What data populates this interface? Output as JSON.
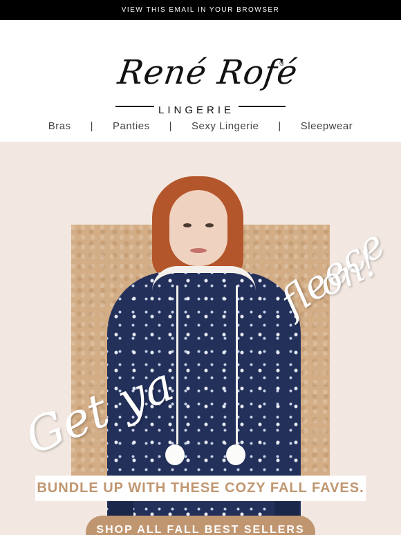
{
  "topbar": {
    "link_text": "VIEW THIS EMAIL IN YOUR BROWSER"
  },
  "brand": {
    "logo_script": "René Rofé",
    "logo_sub": "LINGERIE",
    "registered_mark": "®"
  },
  "nav": {
    "items": [
      "Bras",
      "Panties",
      "Sexy Lingerie",
      "Sleepwear"
    ],
    "separator": "|"
  },
  "hero": {
    "script_line_1": "Get ya",
    "script_line_2": "fleece",
    "script_line_3": "on!",
    "tagline": "BUNDLE UP WITH THESE COZY FALL FAVES.",
    "cta_label": "SHOP ALL FALL BEST SELLERS"
  },
  "colors": {
    "accent": "#c09670",
    "hero_bg": "#f2e8e1",
    "topbar_bg": "#000000",
    "hoodie": "#22305a"
  }
}
